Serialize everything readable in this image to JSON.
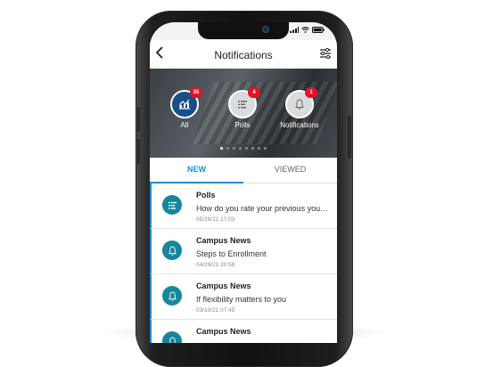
{
  "status": {
    "wifi_icon": "wifi-icon",
    "signal_icon": "signal-icon",
    "battery_icon": "battery-icon"
  },
  "header": {
    "title": "Notifications",
    "back_icon": "chevron-left-icon",
    "filter_icon": "sliders-icon"
  },
  "categories": [
    {
      "label": "All",
      "count": "35",
      "icon": "chart-icon",
      "active": true
    },
    {
      "label": "Polls",
      "count": "4",
      "icon": "poll-icon",
      "active": false
    },
    {
      "label": "Notifications",
      "count": "1",
      "icon": "bell-icon",
      "active": false
    }
  ],
  "carousel": {
    "pages": 8,
    "current": 1
  },
  "tabs": [
    {
      "label": "NEW",
      "selected": true
    },
    {
      "label": "VIEWED",
      "selected": false
    }
  ],
  "notifications": [
    {
      "title": "Polls",
      "message": "How do you rate your previous you…",
      "time": "05/26/21 17:03",
      "icon": "poll-icon"
    },
    {
      "title": "Campus News",
      "message": "Steps to Enrollment",
      "time": "04/29/21 20:59",
      "icon": "bell-icon"
    },
    {
      "title": "Campus News",
      "message": "If flexibility matters to you",
      "time": "03/10/21 07:45",
      "icon": "bell-icon"
    },
    {
      "title": "Campus News",
      "message": "",
      "time": "",
      "icon": "bell-icon"
    }
  ],
  "colors": {
    "accent": "#1a8fd0",
    "active_category": "#1b4e86",
    "badge": "#e3122b",
    "item_icon": "#17869b"
  }
}
